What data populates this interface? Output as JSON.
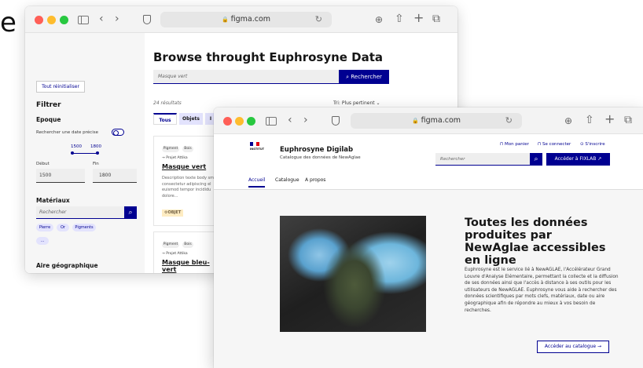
{
  "corner_letter": "e",
  "window_a": {
    "url": "figma.com",
    "sidebar": {
      "reset_label": "Tout réinitialiser",
      "filter_title": "Filtrer",
      "epoque_title": "Epoque",
      "precise_date_label": "Rechercher une date précise",
      "range_min_label": "1500",
      "range_max_label": "1800",
      "start_label": "Début",
      "end_label": "Fin",
      "start_value": "1500",
      "end_value": "1800",
      "materials_title": "Matériaux",
      "materials_placeholder": "Rechercher",
      "chips": [
        "Pierre",
        "Or",
        "Pigments",
        "..."
      ],
      "geo_title": "Aire géographique"
    },
    "main": {
      "title": "Browse throught Euphrosyne Data",
      "search_placeholder": "Masque vert",
      "search_button": "Rechercher",
      "results_count": "24 résultats",
      "sort_label": "Tri: Plus pertinent",
      "tabs": [
        "Tous",
        "Objets",
        "I"
      ],
      "cards": [
        {
          "tags": [
            "Pigment",
            "Bois"
          ],
          "project": "→ Projet Attika",
          "title": "Masque vert",
          "description": "Description texte body sm consectetur adipiscing el euismod tempor incididu dolore...",
          "badge": "OBJET"
        },
        {
          "tags": [
            "Pigment",
            "Bois"
          ],
          "project": "→ Projet Attika",
          "title": "Masque bleu-vert"
        }
      ]
    }
  },
  "window_b": {
    "url": "figma.com",
    "header": {
      "logo_text": "INSTITUT",
      "site_title": "Euphrosyne Digilab",
      "site_subtitle": "Catalogue des données de NewAglae",
      "top_links": [
        "Mon panier",
        "Se connecter",
        "S'inscrire"
      ],
      "search_placeholder": "Rechercher",
      "fixlab_button": "Accéder à FIXLAB"
    },
    "nav": [
      "Accueil",
      "Catalogue",
      "A propos"
    ],
    "hero": {
      "title": "Toutes les données produites par NewAglae accessibles en ligne",
      "paragraph": "Euphrosyne est le service lié à NewAGLAE, l'Accélérateur Grand Louvre d'Analyse Elémentaire, permettant la collecte et la diffusion de ses données ainsi que l'accès à distance à ses outils pour les utilisateurs de NewAGLAE. Euphrosyne vous aide à rechercher des données scientifiques par mots clefs, matériaux, date ou aire géographique afin de répondre au mieux à vos besoin de recherches.",
      "button": "Accéder au catalogue"
    }
  },
  "colors": {
    "accent": "#000091",
    "chip_bg": "#e3e3fd",
    "badge_bg": "#feecc2",
    "sidebar_bg": "#f6f6f6"
  },
  "icons": [
    "sidebar-icon",
    "back-chevron-icon",
    "forward-chevron-icon",
    "shield-icon",
    "lock-icon",
    "reload-icon",
    "download-icon",
    "share-icon",
    "new-tab-icon",
    "tabs-icon",
    "search-icon",
    "cart-icon",
    "user-icon",
    "external-link-icon",
    "arrow-right-icon"
  ]
}
